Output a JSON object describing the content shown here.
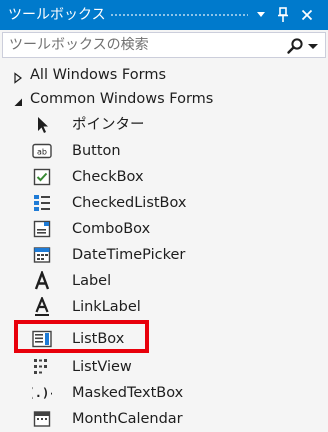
{
  "window": {
    "title": "ツールボックス",
    "buttons": {
      "dropdown_icon": "chevron-down-icon",
      "pin_icon": "pin-icon",
      "close_icon": "close-icon"
    }
  },
  "search": {
    "placeholder": "ツールボックスの検索",
    "value": ""
  },
  "groups": [
    {
      "label": "All Windows Forms",
      "expanded": false
    },
    {
      "label": "Common Windows Forms",
      "expanded": true
    }
  ],
  "items": [
    {
      "label": "ポインター",
      "icon": "pointer-icon"
    },
    {
      "label": "Button",
      "icon": "button-icon"
    },
    {
      "label": "CheckBox",
      "icon": "checkbox-icon"
    },
    {
      "label": "CheckedListBox",
      "icon": "checkedlistbox-icon"
    },
    {
      "label": "ComboBox",
      "icon": "combobox-icon"
    },
    {
      "label": "DateTimePicker",
      "icon": "datetimepicker-icon"
    },
    {
      "label": "Label",
      "icon": "label-icon"
    },
    {
      "label": "LinkLabel",
      "icon": "linklabel-icon"
    },
    {
      "label": "ListBox",
      "icon": "listbox-icon"
    },
    {
      "label": "ListView",
      "icon": "listview-icon"
    },
    {
      "label": "MaskedTextBox",
      "icon": "maskedtextbox-icon"
    },
    {
      "label": "MonthCalendar",
      "icon": "monthcalendar-icon"
    }
  ],
  "colors": {
    "title_bar": "#007acc",
    "highlight_box": "#e8000b",
    "icon_blue": "#1e7bd6",
    "icon_dark": "#424242",
    "check_green": "#388a34"
  }
}
